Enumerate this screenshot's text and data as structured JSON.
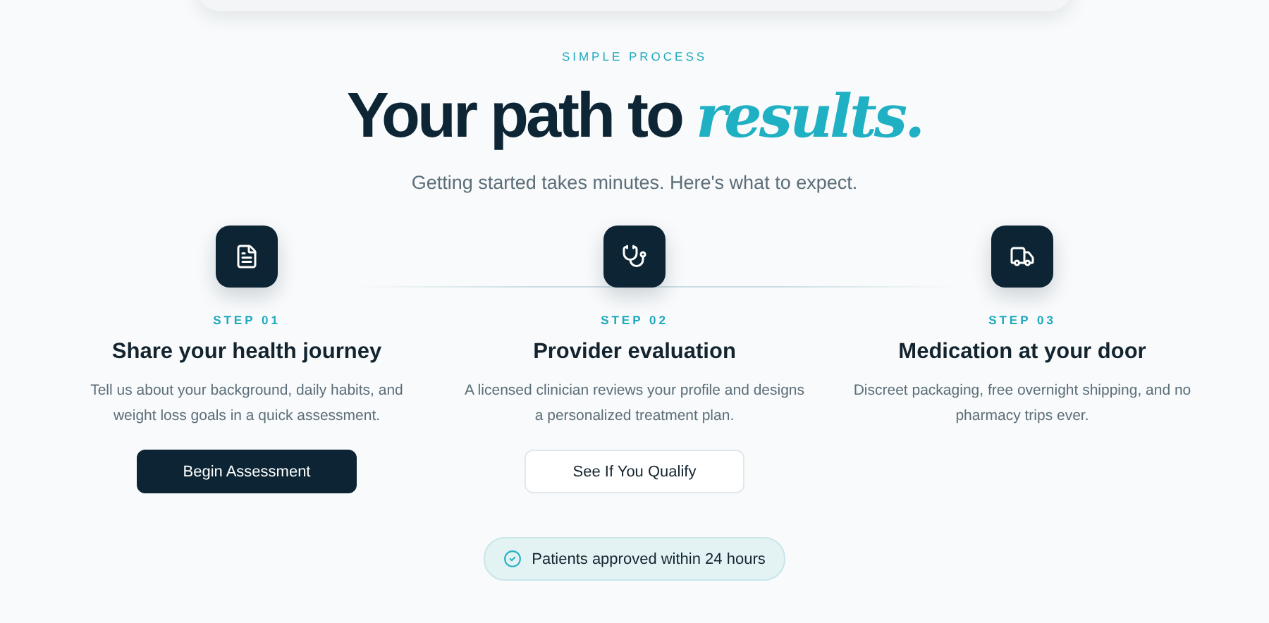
{
  "eyebrow": "SIMPLE PROCESS",
  "heading": {
    "plain": "Your path to",
    "accent": "results."
  },
  "subtitle": "Getting started takes minutes. Here's what to expect.",
  "steps": [
    {
      "kind": "document",
      "step": "STEP 01",
      "title": "Share your health journey",
      "description": "Tell us about your background, daily habits, and weight loss goals in a quick assessment.",
      "button": {
        "label": "Begin Assessment",
        "kind": "primary"
      }
    },
    {
      "kind": "stethoscope",
      "step": "STEP 02",
      "title": "Provider evaluation",
      "description": "A licensed clinician reviews your profile and designs a personalized treatment plan.",
      "button": {
        "label": "See If You Qualify",
        "kind": "secondary"
      }
    },
    {
      "kind": "truck",
      "step": "STEP 03",
      "title": "Medication at your door",
      "description": "Discreet packaging, free overnight shipping, and no pharmacy trips ever."
    }
  ],
  "badge": "Patients approved within 24 hours"
}
